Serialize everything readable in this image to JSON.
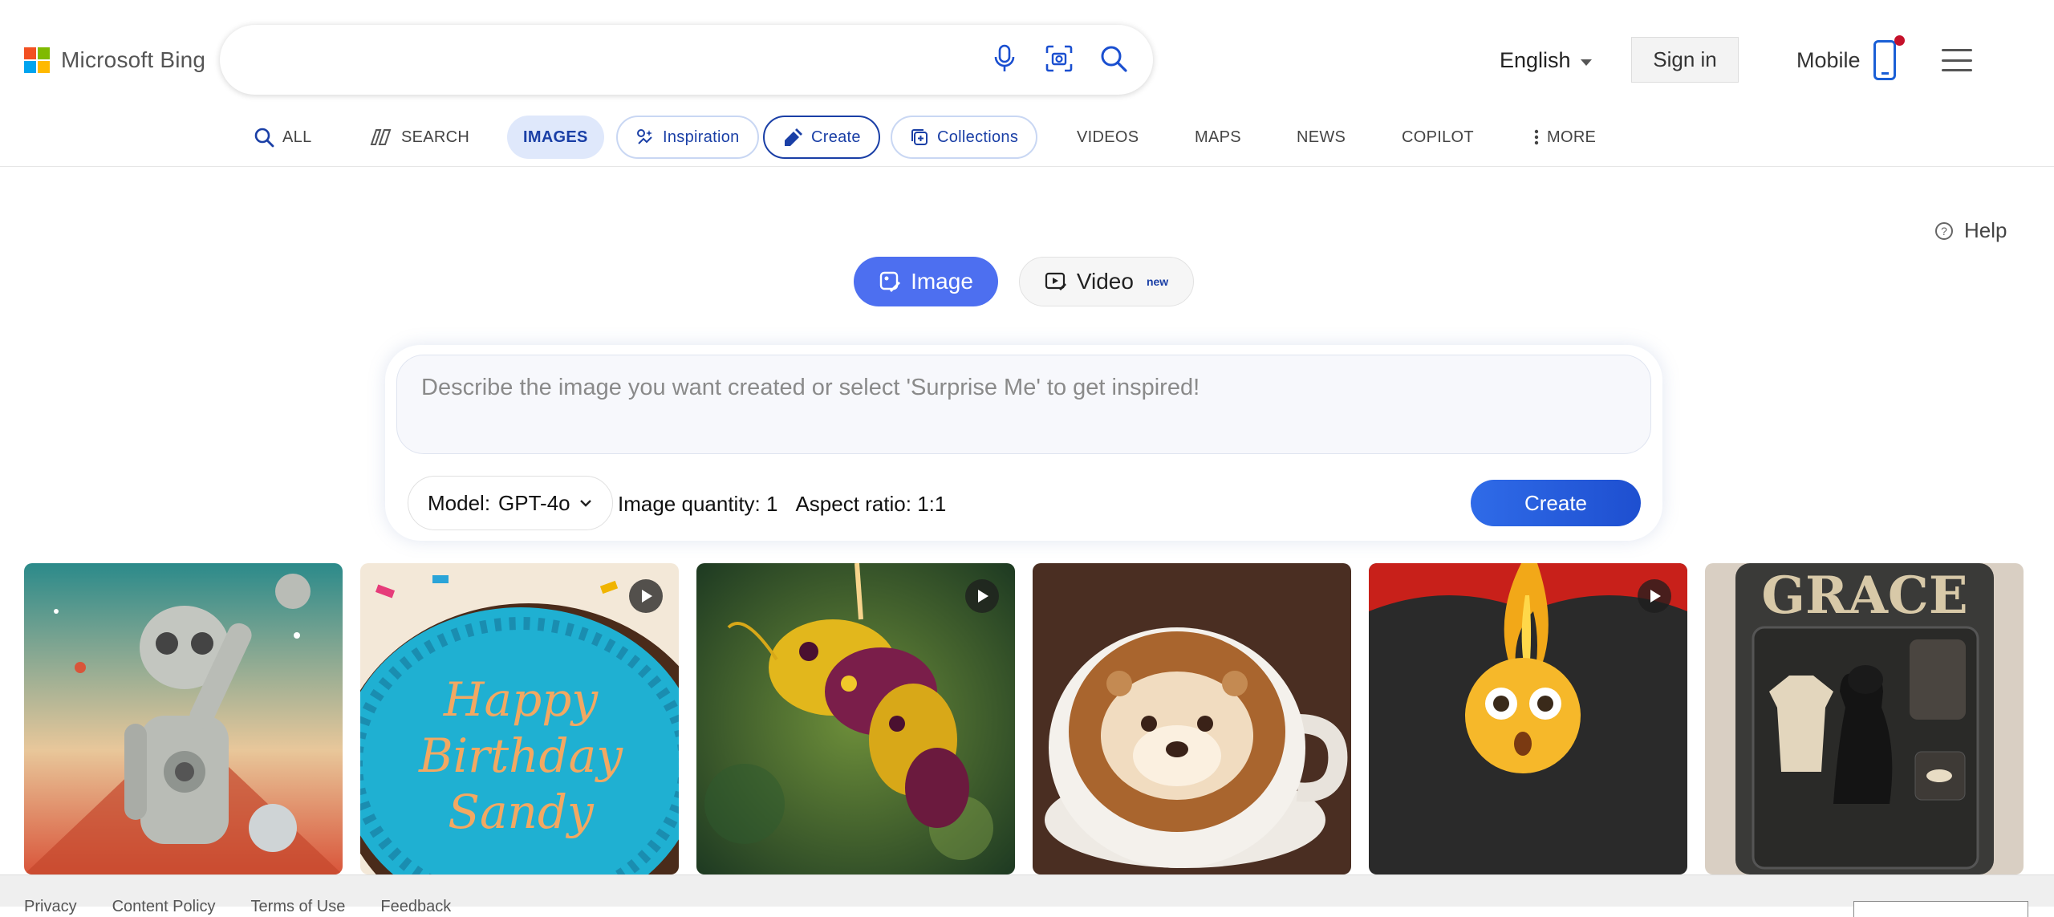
{
  "header": {
    "brand": "Microsoft Bing",
    "logo_colors": [
      "#f25022",
      "#7fba00",
      "#00a4ef",
      "#ffb900"
    ],
    "search_value": "",
    "icons": [
      "microphone-icon",
      "visual-search-icon",
      "search-icon"
    ],
    "language": "English",
    "sign_in": "Sign in",
    "mobile": "Mobile"
  },
  "nav": {
    "all": "ALL",
    "search": "SEARCH",
    "images": "IMAGES",
    "inspiration": "Inspiration",
    "create": "Create",
    "collections": "Collections",
    "videos": "VIDEOS",
    "maps": "MAPS",
    "news": "NEWS",
    "copilot": "COPILOT",
    "more": "MORE"
  },
  "main": {
    "help": "Help",
    "mode_image": "Image",
    "mode_video": "Video",
    "mode_video_badge": "new",
    "prompt_placeholder": "Describe the image you want created or select 'Surprise Me' to get inspired!",
    "model_label": "Model:",
    "model_value": "GPT-4o",
    "image_quantity": "Image quantity: 1",
    "aspect_ratio": "Aspect ratio: 1:1",
    "create_button": "Create",
    "accent_color": "#4d6ff0"
  },
  "gallery": [
    {
      "name": "retro-robot-image",
      "video": false
    },
    {
      "name": "birthday-cake-image",
      "text": "Happy Birthday Sandy",
      "video": true
    },
    {
      "name": "flower-bee-image",
      "video": true
    },
    {
      "name": "otter-latte-image",
      "video": false
    },
    {
      "name": "surprised-emoji-image",
      "video": true
    },
    {
      "name": "grace-dog-image",
      "text": "GRACE",
      "video": false
    }
  ],
  "footer": {
    "links": [
      "Privacy",
      "Content Policy",
      "Terms of Use",
      "Feedback"
    ]
  }
}
